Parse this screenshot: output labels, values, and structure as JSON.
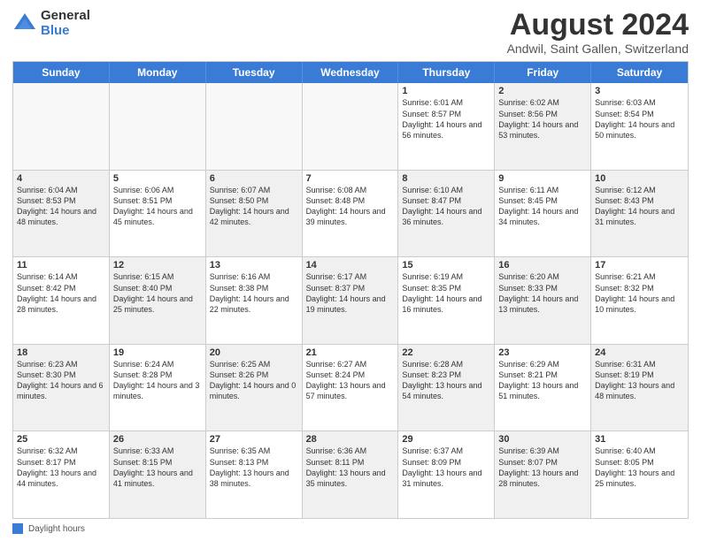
{
  "logo": {
    "general": "General",
    "blue": "Blue"
  },
  "title": "August 2024",
  "location": "Andwil, Saint Gallen, Switzerland",
  "header_days": [
    "Sunday",
    "Monday",
    "Tuesday",
    "Wednesday",
    "Thursday",
    "Friday",
    "Saturday"
  ],
  "weeks": [
    [
      {
        "day": "",
        "text": "",
        "empty": true
      },
      {
        "day": "",
        "text": "",
        "empty": true
      },
      {
        "day": "",
        "text": "",
        "empty": true
      },
      {
        "day": "",
        "text": "",
        "empty": true
      },
      {
        "day": "1",
        "text": "Sunrise: 6:01 AM\nSunset: 8:57 PM\nDaylight: 14 hours and 56 minutes.",
        "shaded": false
      },
      {
        "day": "2",
        "text": "Sunrise: 6:02 AM\nSunset: 8:56 PM\nDaylight: 14 hours and 53 minutes.",
        "shaded": true
      },
      {
        "day": "3",
        "text": "Sunrise: 6:03 AM\nSunset: 8:54 PM\nDaylight: 14 hours and 50 minutes.",
        "shaded": false
      }
    ],
    [
      {
        "day": "4",
        "text": "Sunrise: 6:04 AM\nSunset: 8:53 PM\nDaylight: 14 hours and 48 minutes.",
        "shaded": true
      },
      {
        "day": "5",
        "text": "Sunrise: 6:06 AM\nSunset: 8:51 PM\nDaylight: 14 hours and 45 minutes.",
        "shaded": false
      },
      {
        "day": "6",
        "text": "Sunrise: 6:07 AM\nSunset: 8:50 PM\nDaylight: 14 hours and 42 minutes.",
        "shaded": true
      },
      {
        "day": "7",
        "text": "Sunrise: 6:08 AM\nSunset: 8:48 PM\nDaylight: 14 hours and 39 minutes.",
        "shaded": false
      },
      {
        "day": "8",
        "text": "Sunrise: 6:10 AM\nSunset: 8:47 PM\nDaylight: 14 hours and 36 minutes.",
        "shaded": true
      },
      {
        "day": "9",
        "text": "Sunrise: 6:11 AM\nSunset: 8:45 PM\nDaylight: 14 hours and 34 minutes.",
        "shaded": false
      },
      {
        "day": "10",
        "text": "Sunrise: 6:12 AM\nSunset: 8:43 PM\nDaylight: 14 hours and 31 minutes.",
        "shaded": true
      }
    ],
    [
      {
        "day": "11",
        "text": "Sunrise: 6:14 AM\nSunset: 8:42 PM\nDaylight: 14 hours and 28 minutes.",
        "shaded": false
      },
      {
        "day": "12",
        "text": "Sunrise: 6:15 AM\nSunset: 8:40 PM\nDaylight: 14 hours and 25 minutes.",
        "shaded": true
      },
      {
        "day": "13",
        "text": "Sunrise: 6:16 AM\nSunset: 8:38 PM\nDaylight: 14 hours and 22 minutes.",
        "shaded": false
      },
      {
        "day": "14",
        "text": "Sunrise: 6:17 AM\nSunset: 8:37 PM\nDaylight: 14 hours and 19 minutes.",
        "shaded": true
      },
      {
        "day": "15",
        "text": "Sunrise: 6:19 AM\nSunset: 8:35 PM\nDaylight: 14 hours and 16 minutes.",
        "shaded": false
      },
      {
        "day": "16",
        "text": "Sunrise: 6:20 AM\nSunset: 8:33 PM\nDaylight: 14 hours and 13 minutes.",
        "shaded": true
      },
      {
        "day": "17",
        "text": "Sunrise: 6:21 AM\nSunset: 8:32 PM\nDaylight: 14 hours and 10 minutes.",
        "shaded": false
      }
    ],
    [
      {
        "day": "18",
        "text": "Sunrise: 6:23 AM\nSunset: 8:30 PM\nDaylight: 14 hours and 6 minutes.",
        "shaded": true
      },
      {
        "day": "19",
        "text": "Sunrise: 6:24 AM\nSunset: 8:28 PM\nDaylight: 14 hours and 3 minutes.",
        "shaded": false
      },
      {
        "day": "20",
        "text": "Sunrise: 6:25 AM\nSunset: 8:26 PM\nDaylight: 14 hours and 0 minutes.",
        "shaded": true
      },
      {
        "day": "21",
        "text": "Sunrise: 6:27 AM\nSunset: 8:24 PM\nDaylight: 13 hours and 57 minutes.",
        "shaded": false
      },
      {
        "day": "22",
        "text": "Sunrise: 6:28 AM\nSunset: 8:23 PM\nDaylight: 13 hours and 54 minutes.",
        "shaded": true
      },
      {
        "day": "23",
        "text": "Sunrise: 6:29 AM\nSunset: 8:21 PM\nDaylight: 13 hours and 51 minutes.",
        "shaded": false
      },
      {
        "day": "24",
        "text": "Sunrise: 6:31 AM\nSunset: 8:19 PM\nDaylight: 13 hours and 48 minutes.",
        "shaded": true
      }
    ],
    [
      {
        "day": "25",
        "text": "Sunrise: 6:32 AM\nSunset: 8:17 PM\nDaylight: 13 hours and 44 minutes.",
        "shaded": false
      },
      {
        "day": "26",
        "text": "Sunrise: 6:33 AM\nSunset: 8:15 PM\nDaylight: 13 hours and 41 minutes.",
        "shaded": true
      },
      {
        "day": "27",
        "text": "Sunrise: 6:35 AM\nSunset: 8:13 PM\nDaylight: 13 hours and 38 minutes.",
        "shaded": false
      },
      {
        "day": "28",
        "text": "Sunrise: 6:36 AM\nSunset: 8:11 PM\nDaylight: 13 hours and 35 minutes.",
        "shaded": true
      },
      {
        "day": "29",
        "text": "Sunrise: 6:37 AM\nSunset: 8:09 PM\nDaylight: 13 hours and 31 minutes.",
        "shaded": false
      },
      {
        "day": "30",
        "text": "Sunrise: 6:39 AM\nSunset: 8:07 PM\nDaylight: 13 hours and 28 minutes.",
        "shaded": true
      },
      {
        "day": "31",
        "text": "Sunrise: 6:40 AM\nSunset: 8:05 PM\nDaylight: 13 hours and 25 minutes.",
        "shaded": false
      }
    ]
  ],
  "footer": {
    "legend_label": "Daylight hours"
  }
}
